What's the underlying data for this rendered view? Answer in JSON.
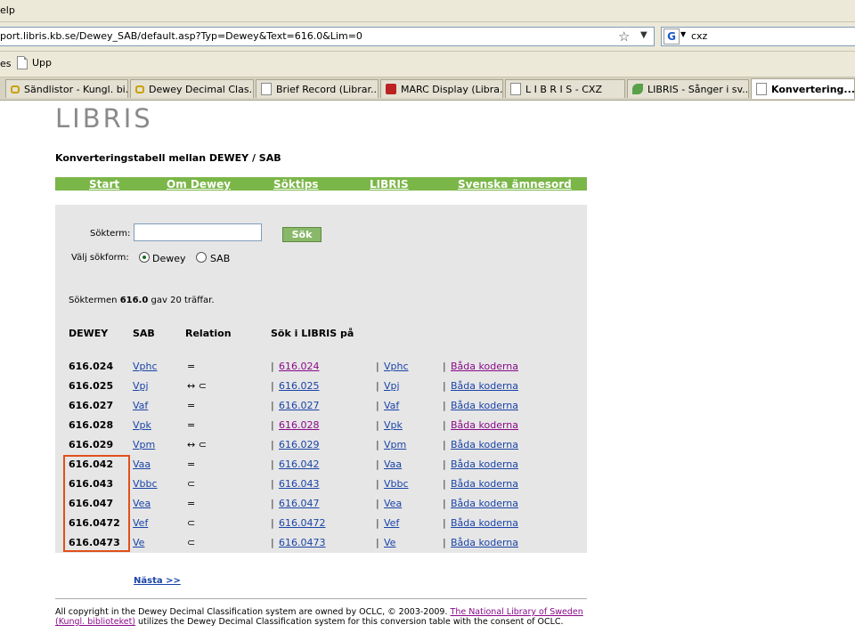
{
  "browser": {
    "menu_fragment": "elp",
    "url": "port.libris.kb.se/Dewey_SAB/default.asp?Typ=Dewey&Text=616.0&Lim=0",
    "search_value": "cxz",
    "search_engine_icon": "G",
    "bookmarks": {
      "fragment": "es",
      "upp": "Upp"
    },
    "tabs": [
      {
        "label": "Sändlistor - Kungl. bi...",
        "icon": "glasses-icon"
      },
      {
        "label": "Dewey Decimal Clas...",
        "icon": "glasses-icon"
      },
      {
        "label": "Brief Record (Librar...",
        "icon": "page-icon"
      },
      {
        "label": "MARC Display (Libra...",
        "icon": "marc-icon"
      },
      {
        "label": "L I B R I S - CXZ",
        "icon": "page-icon"
      },
      {
        "label": "LIBRIS - Sånger i sv...",
        "icon": "leaf-icon"
      },
      {
        "label": "Konvertering...",
        "icon": "page-icon",
        "active": true
      }
    ]
  },
  "page": {
    "logo": "LIBRIS",
    "title": "Konverteringstabell mellan DEWEY / SAB",
    "nav": [
      "Start",
      "Om Dewey",
      "Söktips",
      "LIBRIS",
      "Svenska ämnesord"
    ],
    "search": {
      "label": "Sökterm:",
      "value": "",
      "button": "Sök",
      "form_label": "Välj sökform:",
      "options": [
        "Dewey",
        "SAB"
      ],
      "selected": "Dewey"
    },
    "summary": {
      "prefix": "Söktermen ",
      "term": "616.0",
      "suffix": " gav 20 träffar."
    },
    "columns": [
      "DEWEY",
      "SAB",
      "Relation",
      "Sök i LIBRIS på"
    ],
    "both_label": "Båda koderna",
    "rows": [
      {
        "dewey": "616.024",
        "sab": "Vphc",
        "relation": "=",
        "visited": true
      },
      {
        "dewey": "616.025",
        "sab": "Vpj",
        "relation": "↔ ⊂",
        "visited": false
      },
      {
        "dewey": "616.027",
        "sab": "Vaf",
        "relation": "=",
        "visited": false
      },
      {
        "dewey": "616.028",
        "sab": "Vpk",
        "relation": "=",
        "visited": true
      },
      {
        "dewey": "616.029",
        "sab": "Vpm",
        "relation": "↔ ⊂",
        "visited": false
      },
      {
        "dewey": "616.042",
        "sab": "Vaa",
        "relation": "=",
        "visited": false
      },
      {
        "dewey": "616.043",
        "sab": "Vbbc",
        "relation": "⊂",
        "visited": false
      },
      {
        "dewey": "616.047",
        "sab": "Vea",
        "relation": "=",
        "visited": false
      },
      {
        "dewey": "616.0472",
        "sab": "Vef",
        "relation": "⊂",
        "visited": false
      },
      {
        "dewey": "616.0473",
        "sab": "Ve",
        "relation": "⊂",
        "visited": false
      }
    ],
    "next": "Nästa >>",
    "copyright": {
      "part1": "All copyright in the Dewey Decimal Classification system are owned by OCLC, © 2003-2009. ",
      "link": "The National Library of Sweden (Kungl. biblioteket)",
      "part2": " utilizes the Dewey Decimal Classification system for this conversion table with the consent of OCLC."
    }
  }
}
